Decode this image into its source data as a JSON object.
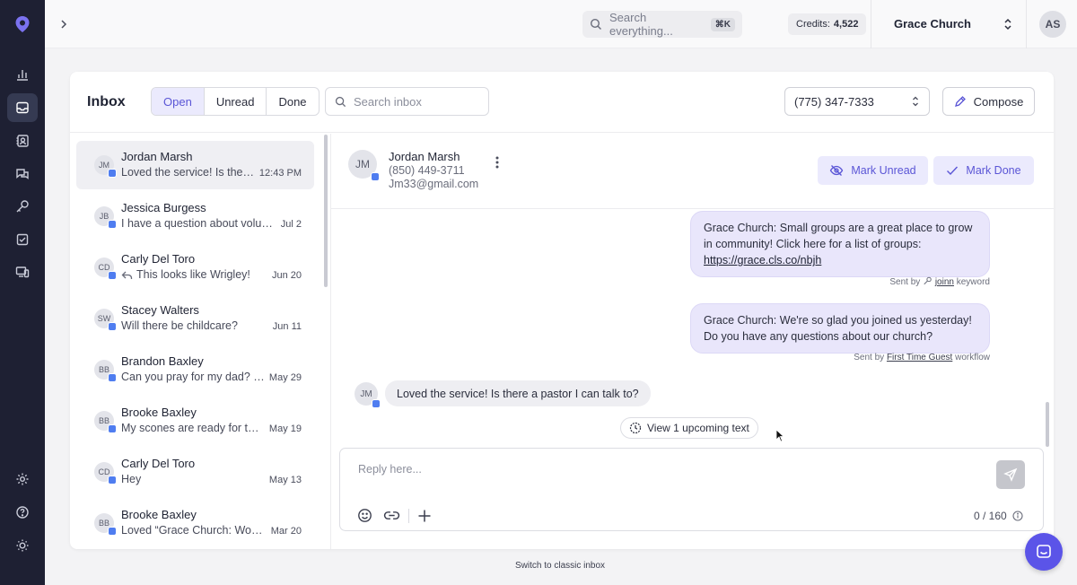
{
  "header": {
    "search_placeholder": "Search everything...",
    "search_shortcut": "⌘K",
    "credits_label": "Credits:",
    "credits_value": "4,522",
    "org_name": "Grace Church",
    "user_initials": "AS"
  },
  "sidebar": {
    "items": [
      {
        "icon": "analytics-icon"
      },
      {
        "icon": "inbox-icon",
        "active": true
      },
      {
        "icon": "contacts-icon"
      },
      {
        "icon": "chat-icon"
      },
      {
        "icon": "keyword-icon"
      },
      {
        "icon": "tasks-icon"
      },
      {
        "icon": "devices-icon"
      }
    ],
    "bottom_items": [
      {
        "icon": "settings-icon"
      },
      {
        "icon": "help-icon"
      },
      {
        "icon": "theme-icon"
      }
    ]
  },
  "inbox": {
    "title": "Inbox",
    "filters": [
      "Open",
      "Unread",
      "Done"
    ],
    "active_filter": "Open",
    "search_placeholder": "Search inbox",
    "phone_number": "(775) 347-7333",
    "compose_label": "Compose"
  },
  "conversations": [
    {
      "initials": "JM",
      "name": "Jordan Marsh",
      "preview": "Loved the service! Is there a pastor I can talk to?",
      "date": "12:43 PM",
      "selected": true
    },
    {
      "initials": "JB",
      "name": "Jessica Burgess",
      "preview": "I have a question about volunteering",
      "date": "Jul 2"
    },
    {
      "initials": "CD",
      "name": "Carly Del Toro",
      "preview": "This looks like Wrigley!",
      "date": "Jun 20",
      "reply_icon": true
    },
    {
      "initials": "SW",
      "name": "Stacey Walters",
      "preview": "Will there be childcare?",
      "date": "Jun 11"
    },
    {
      "initials": "BB",
      "name": "Brandon Baxley",
      "preview": "Can you pray for my dad? He is sick",
      "date": "May 29"
    },
    {
      "initials": "BB",
      "name": "Brooke Baxley",
      "preview": "My scones are ready for the bake sale",
      "date": "May 19"
    },
    {
      "initials": "CD",
      "name": "Carly Del Toro",
      "preview": "Hey",
      "date": "May 13"
    },
    {
      "initials": "BB",
      "name": "Brooke Baxley",
      "preview": "Loved “Grace Church: Worship night”",
      "date": "Mar 20"
    }
  ],
  "thread": {
    "contact_initials": "JM",
    "contact_name": "Jordan Marsh",
    "contact_phone": "(850) 449-3711",
    "contact_email": "Jm33@gmail.com",
    "mark_unread_label": "Mark Unread",
    "mark_done_label": "Mark Done",
    "messages": {
      "m1_text": "Grace Church: Small groups are a great place to grow in community! Click here for a list of groups:",
      "m1_link": "https://grace.cls.co/nbjh",
      "m1_meta_prefix": "Sent by",
      "m1_meta_name": "joinn",
      "m1_meta_suffix": "keyword",
      "m2_text": "Grace Church: We're so glad you joined us yesterday! Do you have any questions about our church?",
      "m2_meta_prefix": "Sent by",
      "m2_meta_name": "First Time Guest",
      "m2_meta_suffix": "workflow",
      "m3_initials": "JM",
      "m3_text": "Loved the service! Is there a pastor I can talk to?"
    },
    "upcoming_label": "View 1 upcoming text",
    "reply_placeholder": "Reply here...",
    "char_count": "0 / 160"
  },
  "footer": {
    "classic_link": "Switch to classic inbox"
  },
  "colors": {
    "rail_bg": "#1e2033",
    "accent": "#5a55d6",
    "accent_bg": "#ebeafd",
    "help_fab": "#5b54e8"
  }
}
